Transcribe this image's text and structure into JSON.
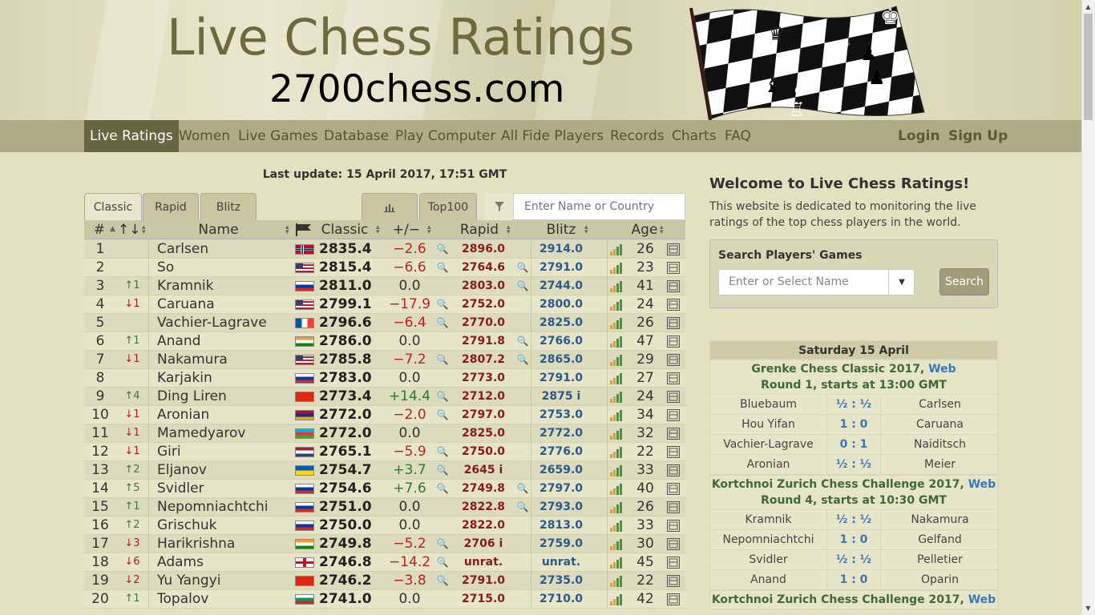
{
  "header": {
    "title": "Live Chess Ratings",
    "subtitle": "2700chess.com"
  },
  "nav": {
    "items": [
      "Live Ratings",
      "Women",
      "Live Games",
      "Database",
      "Play Computer",
      "All Fide Players",
      "Records",
      "Charts",
      "FAQ"
    ],
    "active": "Live Ratings",
    "login": "Login",
    "signup": "Sign Up"
  },
  "last_update": "Last update: 15 April 2017, 17:51 GMT",
  "tabs": {
    "classic": "Classic",
    "rapid": "Rapid",
    "blitz": "Blitz",
    "top100": "Top100",
    "chart_icon": "bar-chart-icon"
  },
  "filter": {
    "placeholder": "Enter Name or Country",
    "icon": "filter-icon"
  },
  "table": {
    "headers": {
      "rank": "#",
      "change": "↑↓",
      "name": "Name",
      "classic": "Classic",
      "diff": "+/−",
      "rapid": "Rapid",
      "blitz": "Blitz",
      "age": "Age"
    },
    "rows": [
      {
        "rank": "1",
        "chg": "",
        "chg_dir": "",
        "name": "Carlsen",
        "flag": "NOR",
        "classic": "2835.4",
        "diff": "−2.6",
        "diff_sign": "neg",
        "rapid": "2896.0",
        "rapid_mag": true,
        "blitz": "2914.0",
        "blitz_mag": false,
        "age": "26"
      },
      {
        "rank": "2",
        "chg": "",
        "chg_dir": "",
        "name": "So",
        "flag": "USA",
        "classic": "2815.4",
        "diff": "−6.6",
        "diff_sign": "neg",
        "rapid": "2764.6",
        "rapid_mag": true,
        "blitz": "2791.0",
        "blitz_mag": true,
        "age": "23"
      },
      {
        "rank": "3",
        "chg": "↑1",
        "chg_dir": "up",
        "name": "Kramnik",
        "flag": "RUS",
        "classic": "2811.0",
        "diff": "0.0",
        "diff_sign": "zero",
        "rapid": "2803.0",
        "rapid_mag": false,
        "blitz": "2744.0",
        "blitz_mag": true,
        "age": "41"
      },
      {
        "rank": "4",
        "chg": "↓1",
        "chg_dir": "down",
        "name": "Caruana",
        "flag": "USA",
        "classic": "2799.1",
        "diff": "−17.9",
        "diff_sign": "neg",
        "rapid": "2752.0",
        "rapid_mag": true,
        "blitz": "2800.0",
        "blitz_mag": false,
        "age": "24"
      },
      {
        "rank": "5",
        "chg": "",
        "chg_dir": "",
        "name": "Vachier-Lagrave",
        "flag": "FRA",
        "classic": "2796.6",
        "diff": "−6.4",
        "diff_sign": "neg",
        "rapid": "2770.0",
        "rapid_mag": true,
        "blitz": "2825.0",
        "blitz_mag": false,
        "age": "26"
      },
      {
        "rank": "6",
        "chg": "↑1",
        "chg_dir": "up",
        "name": "Anand",
        "flag": "IND",
        "classic": "2786.0",
        "diff": "0.0",
        "diff_sign": "zero",
        "rapid": "2791.8",
        "rapid_mag": false,
        "blitz": "2766.0",
        "blitz_mag": true,
        "age": "47"
      },
      {
        "rank": "7",
        "chg": "↓1",
        "chg_dir": "down",
        "name": "Nakamura",
        "flag": "USA",
        "classic": "2785.8",
        "diff": "−7.2",
        "diff_sign": "neg",
        "rapid": "2807.2",
        "rapid_mag": true,
        "blitz": "2865.0",
        "blitz_mag": true,
        "age": "29"
      },
      {
        "rank": "8",
        "chg": "",
        "chg_dir": "",
        "name": "Karjakin",
        "flag": "RUS",
        "classic": "2783.0",
        "diff": "0.0",
        "diff_sign": "zero",
        "rapid": "2773.0",
        "rapid_mag": false,
        "blitz": "2791.0",
        "blitz_mag": false,
        "age": "27"
      },
      {
        "rank": "9",
        "chg": "↑4",
        "chg_dir": "up",
        "name": "Ding Liren",
        "flag": "CHN",
        "classic": "2773.4",
        "diff": "+14.4",
        "diff_sign": "pos",
        "rapid": "2712.0",
        "rapid_mag": true,
        "blitz": "2875 i",
        "blitz_mag": false,
        "age": "24"
      },
      {
        "rank": "10",
        "chg": "↓1",
        "chg_dir": "down",
        "name": "Aronian",
        "flag": "ARM",
        "classic": "2772.0",
        "diff": "−2.0",
        "diff_sign": "neg",
        "rapid": "2797.0",
        "rapid_mag": true,
        "blitz": "2753.0",
        "blitz_mag": false,
        "age": "34"
      },
      {
        "rank": "11",
        "chg": "↓1",
        "chg_dir": "down",
        "name": "Mamedyarov",
        "flag": "AZE",
        "classic": "2772.0",
        "diff": "0.0",
        "diff_sign": "zero",
        "rapid": "2825.0",
        "rapid_mag": false,
        "blitz": "2772.0",
        "blitz_mag": false,
        "age": "32"
      },
      {
        "rank": "12",
        "chg": "↓1",
        "chg_dir": "down",
        "name": "Giri",
        "flag": "NED",
        "classic": "2765.1",
        "diff": "−5.9",
        "diff_sign": "neg",
        "rapid": "2750.0",
        "rapid_mag": true,
        "blitz": "2776.0",
        "blitz_mag": false,
        "age": "22"
      },
      {
        "rank": "13",
        "chg": "↑2",
        "chg_dir": "up",
        "name": "Eljanov",
        "flag": "UKR",
        "classic": "2754.7",
        "diff": "+3.7",
        "diff_sign": "pos",
        "rapid": "2645 i",
        "rapid_mag": true,
        "blitz": "2659.0",
        "blitz_mag": false,
        "age": "33"
      },
      {
        "rank": "14",
        "chg": "↑5",
        "chg_dir": "up",
        "name": "Svidler",
        "flag": "RUS",
        "classic": "2754.6",
        "diff": "+7.6",
        "diff_sign": "pos",
        "rapid": "2749.8",
        "rapid_mag": true,
        "blitz": "2797.0",
        "blitz_mag": true,
        "age": "40"
      },
      {
        "rank": "15",
        "chg": "↑1",
        "chg_dir": "up",
        "name": "Nepomniachtchi",
        "flag": "RUS",
        "classic": "2751.0",
        "diff": "0.0",
        "diff_sign": "zero",
        "rapid": "2822.8",
        "rapid_mag": false,
        "blitz": "2793.0",
        "blitz_mag": true,
        "age": "26"
      },
      {
        "rank": "16",
        "chg": "↑2",
        "chg_dir": "up",
        "name": "Grischuk",
        "flag": "RUS",
        "classic": "2750.0",
        "diff": "0.0",
        "diff_sign": "zero",
        "rapid": "2822.0",
        "rapid_mag": false,
        "blitz": "2813.0",
        "blitz_mag": false,
        "age": "33"
      },
      {
        "rank": "17",
        "chg": "↓3",
        "chg_dir": "down",
        "name": "Harikrishna",
        "flag": "IND",
        "classic": "2749.8",
        "diff": "−5.2",
        "diff_sign": "neg",
        "rapid": "2706 i",
        "rapid_mag": true,
        "blitz": "2759.0",
        "blitz_mag": false,
        "age": "30"
      },
      {
        "rank": "18",
        "chg": "↓6",
        "chg_dir": "down",
        "name": "Adams",
        "flag": "ENG",
        "classic": "2746.8",
        "diff": "−14.2",
        "diff_sign": "neg",
        "rapid": "unrat.",
        "rapid_mag": true,
        "blitz": "unrat.",
        "blitz_mag": false,
        "age": "45"
      },
      {
        "rank": "19",
        "chg": "↓2",
        "chg_dir": "down",
        "name": "Yu Yangyi",
        "flag": "CHN",
        "classic": "2746.2",
        "diff": "−3.8",
        "diff_sign": "neg",
        "rapid": "2791.0",
        "rapid_mag": true,
        "blitz": "2735.0",
        "blitz_mag": false,
        "age": "22"
      },
      {
        "rank": "20",
        "chg": "↑1",
        "chg_dir": "up",
        "name": "Topalov",
        "flag": "BUL",
        "classic": "2741.0",
        "diff": "0.0",
        "diff_sign": "zero",
        "rapid": "2715.0",
        "rapid_mag": false,
        "blitz": "2710.0",
        "blitz_mag": false,
        "age": "42"
      }
    ]
  },
  "sidebar": {
    "welcome_title": "Welcome to Live Chess Ratings!",
    "welcome_text": "This website is dedicated to monitoring the live ratings of the top chess players in the world.",
    "search_title": "Search Players' Games",
    "search_placeholder": "Enter or Select Name",
    "search_button": "Search"
  },
  "games": {
    "day": "Saturday 15 April",
    "events": [
      {
        "name": "Grenke Chess Classic 2017,",
        "web": "Web",
        "round": "Round 1, starts at 13:00 GMT",
        "games": [
          {
            "white": "Bluebaum",
            "result": "½ : ½",
            "black": "Carlsen"
          },
          {
            "white": "Hou Yifan",
            "result": "1 : 0",
            "black": "Caruana"
          },
          {
            "white": "Vachier-Lagrave",
            "result": "0 : 1",
            "black": "Naiditsch"
          },
          {
            "white": "Aronian",
            "result": "½ : ½",
            "black": "Meier"
          }
        ]
      },
      {
        "name": "Kortchnoi Zurich Chess Challenge 2017,",
        "web": "Web",
        "round": "Round 4, starts at 10:30 GMT",
        "games": [
          {
            "white": "Kramnik",
            "result": "½ : ½",
            "black": "Nakamura"
          },
          {
            "white": "Nepomniachtchi",
            "result": "1 : 0",
            "black": "Gelfand"
          },
          {
            "white": "Svidler",
            "result": "½ : ½",
            "black": "Pelletier"
          },
          {
            "white": "Anand",
            "result": "1 : 0",
            "black": "Oparin"
          }
        ]
      },
      {
        "name": "Kortchnoi Zurich Chess Challenge 2017,",
        "web": "Web"
      }
    ]
  },
  "colors": {
    "nav_bg": "#aeac86",
    "nav_active": "#666640",
    "page_bg": "#e2e1c0",
    "rapid": "#8b1a1a",
    "blitz": "#2b5a8b",
    "event": "#3f6a33"
  }
}
